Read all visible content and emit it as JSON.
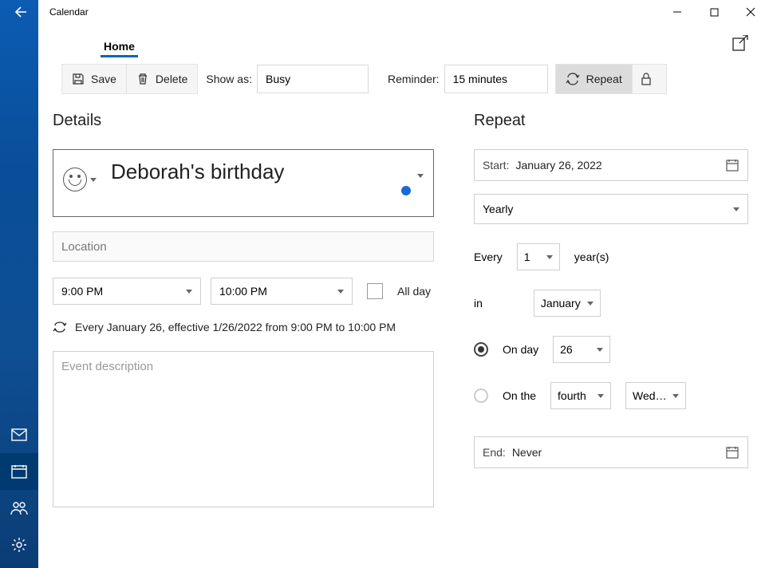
{
  "app_title": "Calendar",
  "tab": {
    "home": "Home"
  },
  "toolbar": {
    "save": "Save",
    "delete": "Delete",
    "show_as_label": "Show as:",
    "show_as_value": "Busy",
    "reminder_label": "Reminder:",
    "reminder_value": "15 minutes",
    "repeat": "Repeat"
  },
  "details": {
    "heading": "Details",
    "event_title": "Deborah's birthday",
    "location_placeholder": "Location",
    "start_time": "9:00 PM",
    "end_time": "10:00 PM",
    "all_day_label": "All day",
    "recurrence_text": "Every January 26, effective 1/26/2022 from 9:00 PM to 10:00 PM",
    "description_placeholder": "Event description"
  },
  "repeat": {
    "heading": "Repeat",
    "start_label": "Start:",
    "start_value": "January 26, 2022",
    "pattern": "Yearly",
    "every_label": "Every",
    "every_value": "1",
    "years_label": "year(s)",
    "in_label": "in",
    "in_month": "January",
    "on_day_label": "On day",
    "on_day_value": "26",
    "on_the_label": "On the",
    "on_the_ordinal": "fourth",
    "on_the_weekday": "Wed…",
    "end_label": "End:",
    "end_value": "Never"
  },
  "colors": {
    "calendar_dot": "#1a6bd8"
  }
}
